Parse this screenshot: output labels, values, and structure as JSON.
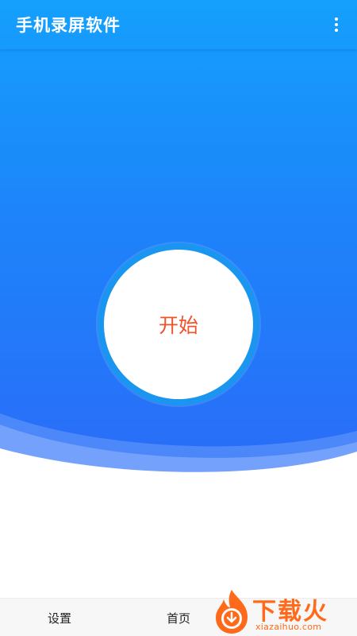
{
  "appbar": {
    "title": "手机录屏软件",
    "menu_icon": "more-vert-icon"
  },
  "main": {
    "start_label": "开始"
  },
  "bottom_nav": {
    "items": [
      {
        "label": "设置"
      },
      {
        "label": "首页"
      }
    ]
  },
  "watermark": {
    "brand": "下载火",
    "url": "xiazaihuo.com",
    "icon": "flame-download-icon"
  },
  "colors": {
    "gradient_top": "#14a0fc",
    "gradient_bottom": "#2a6cf8",
    "start_text": "#f0522a",
    "watermark": "#ff6a1a"
  }
}
